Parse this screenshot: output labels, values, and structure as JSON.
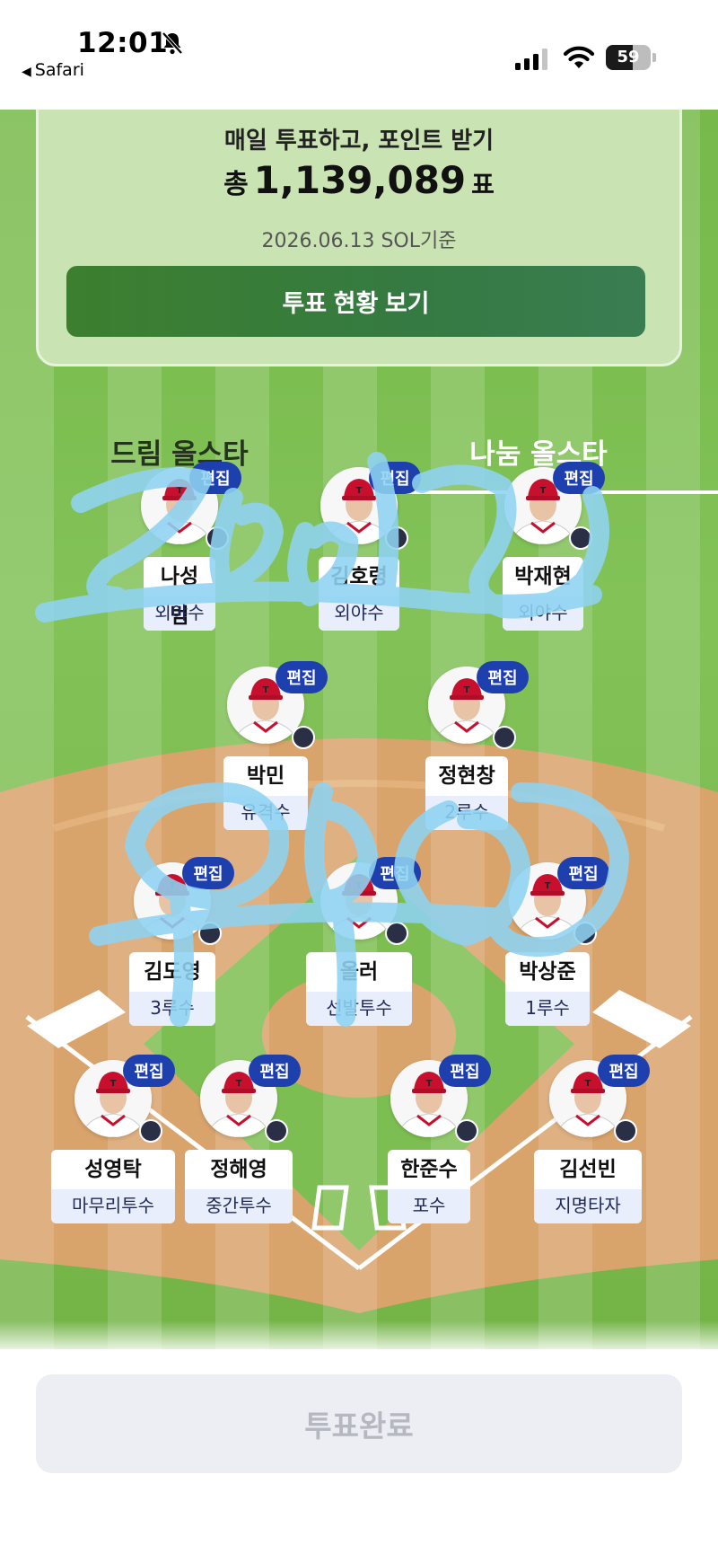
{
  "status_bar": {
    "time": "12:01",
    "back_app": "Safari",
    "battery": 59
  },
  "vote_card": {
    "heading": "매일 투표하고, 포인트 받기",
    "total_prefix": "총",
    "total_votes": "1,139,089",
    "total_unit": "표",
    "date": "2026.06.13 SOL기준",
    "status_button": "투표 현황 보기"
  },
  "tabs": [
    {
      "label": "드림 올스타",
      "selected": false
    },
    {
      "label": "나눔 올스타",
      "selected": true
    }
  ],
  "edit_label": "편집",
  "players": {
    "lf": {
      "name": "나성범",
      "position": "외야수"
    },
    "cf": {
      "name": "김호령",
      "position": "외야수"
    },
    "rf": {
      "name": "박재현",
      "position": "외야수"
    },
    "ss": {
      "name": "박민",
      "position": "유격수"
    },
    "b2": {
      "name": "정현창",
      "position": "2루수"
    },
    "b3": {
      "name": "김도영",
      "position": "3루수"
    },
    "sp": {
      "name": "올러",
      "position": "선발투수"
    },
    "b1": {
      "name": "박상준",
      "position": "1루수"
    },
    "cl": {
      "name": "성영탁",
      "position": "마무리투수"
    },
    "rp": {
      "name": "정해영",
      "position": "중간투수"
    },
    "c": {
      "name": "한준수",
      "position": "포수"
    },
    "dh": {
      "name": "김선빈",
      "position": "지명타자"
    }
  },
  "complete_button": "투표완료",
  "colors": {
    "grass": "#7dbe52",
    "dirt": "#d9a36c",
    "edit_badge": "#1e3fae",
    "status_button": "#3a7d3a",
    "scribble": "#8fd3f2"
  }
}
